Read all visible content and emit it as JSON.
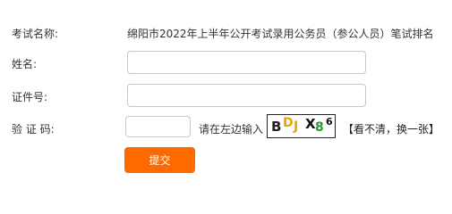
{
  "exam": {
    "label": "考试名称:",
    "value": "绵阳市2022年上半年公开考试录用公务员（参公人员）笔试排名"
  },
  "form": {
    "name_label": "姓名:",
    "name_value": "",
    "id_label": "证件号:",
    "id_value": "",
    "captcha_label": "验 证 码:",
    "captcha_value": "",
    "captcha_hint": "请在左边输入",
    "captcha_chars": [
      "B",
      "D",
      "J",
      "X",
      "8",
      "6"
    ],
    "captcha_colors": [
      "#222222",
      "#e8a400",
      "#e8a400",
      "#111111",
      "#2a9a2a",
      "#111111"
    ],
    "refresh_label": "【看不清，换一张】",
    "submit_label": "提交"
  },
  "colors": {
    "accent": "#ff6a00"
  }
}
